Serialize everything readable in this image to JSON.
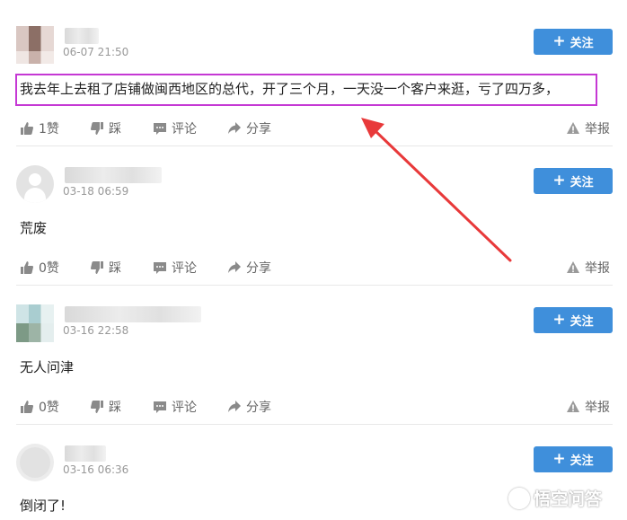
{
  "follow_label": "关注",
  "actions": {
    "step_label": "踩",
    "comment_label": "评论",
    "share_label": "分享",
    "report_label": "举报"
  },
  "comments": [
    {
      "time": "06-07 21:50",
      "like_label": "1赞",
      "text": "我去年上去租了店铺做闽西地区的总代，开了三个月，一天没一个客户来逛，亏了四万多，"
    },
    {
      "time": "03-18 06:59",
      "like_label": "0赞",
      "text": "荒废"
    },
    {
      "time": "03-16 22:58",
      "like_label": "0赞",
      "text": "无人问津"
    },
    {
      "time": "03-16 06:36",
      "text": "倒闭了!"
    }
  ],
  "watermark": "悟空问答",
  "colors": {
    "follow_button": "#3f8fdb",
    "highlight_border": "#c538d4",
    "arrow": "#e8393a"
  }
}
